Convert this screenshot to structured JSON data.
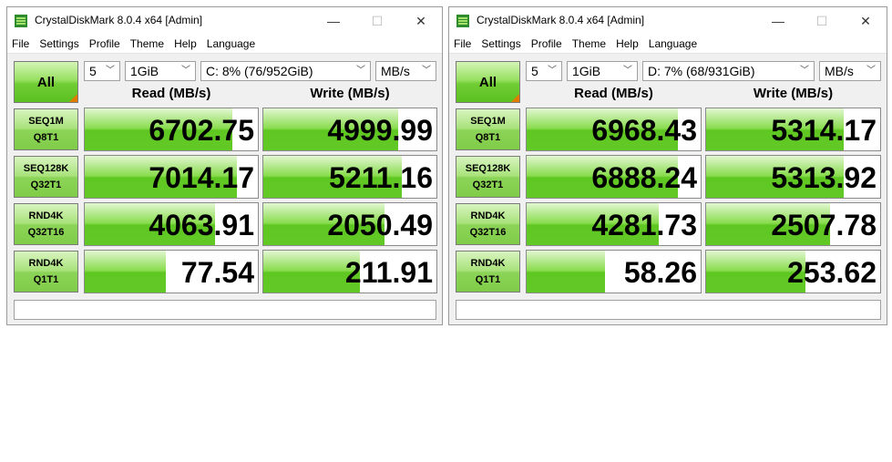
{
  "windows": [
    {
      "title": "CrystalDiskMark 8.0.4 x64 [Admin]",
      "menu": [
        "File",
        "Settings",
        "Profile",
        "Theme",
        "Help",
        "Language"
      ],
      "all_label": "All",
      "count": "5",
      "size": "1GiB",
      "drive": "C: 8% (76/952GiB)",
      "unit": "MB/s",
      "read_header": "Read (MB/s)",
      "write_header": "Write (MB/s)",
      "tests": [
        {
          "line1": "SEQ1M",
          "line2": "Q8T1",
          "read": "6702.75",
          "write": "4999.99",
          "read_fill": 0.85,
          "write_fill": 0.78
        },
        {
          "line1": "SEQ128K",
          "line2": "Q32T1",
          "read": "7014.17",
          "write": "5211.16",
          "read_fill": 0.88,
          "write_fill": 0.8
        },
        {
          "line1": "RND4K",
          "line2": "Q32T16",
          "read": "4063.91",
          "write": "2050.49",
          "read_fill": 0.75,
          "write_fill": 0.7
        },
        {
          "line1": "RND4K",
          "line2": "Q1T1",
          "read": "77.54",
          "write": "211.91",
          "read_fill": 0.47,
          "write_fill": 0.56
        }
      ]
    },
    {
      "title": "CrystalDiskMark 8.0.4 x64 [Admin]",
      "menu": [
        "File",
        "Settings",
        "Profile",
        "Theme",
        "Help",
        "Language"
      ],
      "all_label": "All",
      "count": "5",
      "size": "1GiB",
      "drive": "D: 7% (68/931GiB)",
      "unit": "MB/s",
      "read_header": "Read (MB/s)",
      "write_header": "Write (MB/s)",
      "tests": [
        {
          "line1": "SEQ1M",
          "line2": "Q8T1",
          "read": "6968.43",
          "write": "5314.17",
          "read_fill": 0.87,
          "write_fill": 0.79
        },
        {
          "line1": "SEQ128K",
          "line2": "Q32T1",
          "read": "6888.24",
          "write": "5313.92",
          "read_fill": 0.87,
          "write_fill": 0.79
        },
        {
          "line1": "RND4K",
          "line2": "Q32T16",
          "read": "4281.73",
          "write": "2507.78",
          "read_fill": 0.76,
          "write_fill": 0.71
        },
        {
          "line1": "RND4K",
          "line2": "Q1T1",
          "read": "58.26",
          "write": "253.62",
          "read_fill": 0.45,
          "write_fill": 0.57
        }
      ]
    }
  ],
  "colors": {
    "accent_green": "#5fc722",
    "corner_orange": "#e07b00"
  }
}
